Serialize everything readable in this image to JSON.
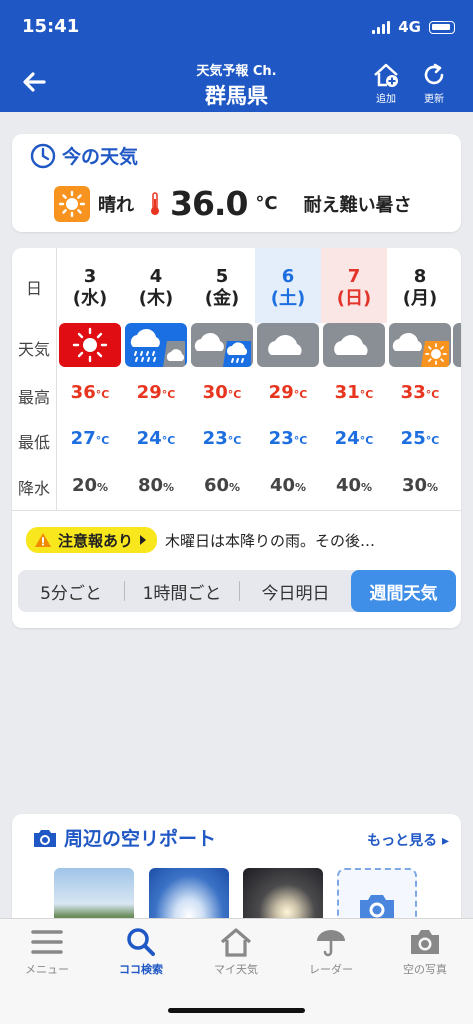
{
  "status": {
    "time": "15:41",
    "network": "4G"
  },
  "header": {
    "subtitle": "天気予報 Ch.",
    "title": "群馬県",
    "add_label": "追加",
    "refresh_label": "更新"
  },
  "now": {
    "title": "今の天気",
    "condition": "晴れ",
    "temperature": "36.0",
    "unit": "°C",
    "comment": "耐え難い暑さ"
  },
  "week": {
    "labels": {
      "day": "日",
      "weather": "天気",
      "max": "最高",
      "min": "最低",
      "rain": "降水"
    },
    "days": [
      {
        "day": "3",
        "dow": "(水)",
        "icon": "sunny-extreme-heat-icon",
        "max": "36",
        "min": "27",
        "rain": "20"
      },
      {
        "day": "4",
        "dow": "(木)",
        "icon": "heavy-rain-cloudy-icon",
        "max": "29",
        "min": "24",
        "rain": "80"
      },
      {
        "day": "5",
        "dow": "(金)",
        "icon": "cloudy-rain-icon",
        "max": "30",
        "min": "23",
        "rain": "60"
      },
      {
        "day": "6",
        "dow": "(土)",
        "icon": "cloudy-icon",
        "max": "29",
        "min": "23",
        "rain": "40"
      },
      {
        "day": "7",
        "dow": "(日)",
        "icon": "cloudy-icon",
        "max": "31",
        "min": "24",
        "rain": "40"
      },
      {
        "day": "8",
        "dow": "(月)",
        "icon": "cloudy-sunny-icon",
        "max": "33",
        "min": "25",
        "rain": "30"
      }
    ],
    "temp_unit": "°C",
    "rain_unit": "%"
  },
  "alert": {
    "badge": "注意報あり",
    "text": "木曜日は本降りの雨。その後…"
  },
  "segments": [
    "5分ごと",
    "1時間ごと",
    "今日明日",
    "週間天気"
  ],
  "report": {
    "title": "周辺の空リポート",
    "more": "もっと見る"
  },
  "tabs": [
    "メニュー",
    "ココ検索",
    "マイ天気",
    "レーダー",
    "空の写真"
  ],
  "colors": {
    "header": "#1f57c4",
    "max_temp": "#e8351f",
    "min_temp": "#1d6fe0",
    "alert": "#f8e71c",
    "active_segment": "#3f8ee8"
  }
}
